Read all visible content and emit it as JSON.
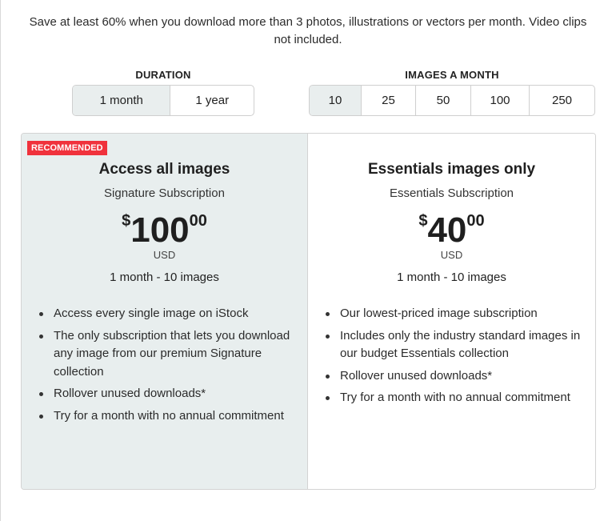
{
  "intro": "Save at least 60% when you download more than 3 photos, illustrations or vectors per month. Video clips not included.",
  "duration": {
    "label": "DURATION",
    "options": [
      "1 month",
      "1 year"
    ],
    "selected": "1 month"
  },
  "images_per_month": {
    "label": "IMAGES A MONTH",
    "options": [
      "10",
      "25",
      "50",
      "100",
      "250"
    ],
    "selected": "10"
  },
  "plans": [
    {
      "badge": "RECOMMENDED",
      "title": "Access all images",
      "subtitle": "Signature Subscription",
      "currency_symbol": "$",
      "price_whole": "100",
      "price_cents": "00",
      "currency": "USD",
      "period": "1 month - 10 images",
      "features": [
        "Access every single image on iStock",
        "The only subscription that lets you download any image from our premium Signature collection",
        "Rollover unused downloads*",
        "Try for a month with no annual commitment"
      ]
    },
    {
      "title": "Essentials images only",
      "subtitle": "Essentials Subscription",
      "currency_symbol": "$",
      "price_whole": "40",
      "price_cents": "00",
      "currency": "USD",
      "period": "1 month - 10 images",
      "features": [
        "Our lowest-priced image subscription",
        "Includes only the industry standard images in our budget Essentials collection",
        "Rollover unused downloads*",
        "Try for a month with no annual commitment"
      ]
    }
  ],
  "colors": {
    "badge": "#f0323c",
    "recommended_bg": "#e8eeee",
    "selected_option_bg": "#e9eeee"
  }
}
